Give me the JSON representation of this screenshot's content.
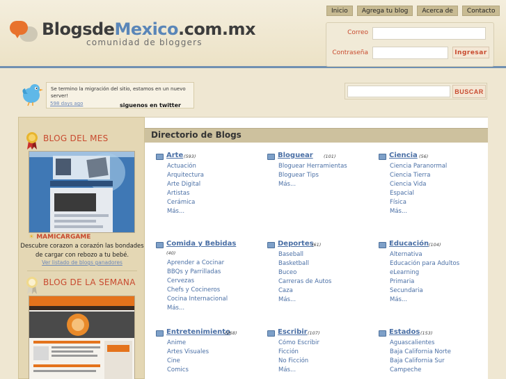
{
  "brand": {
    "title_part1": "BlogsdeMexico",
    "title_part2": ".com.mx",
    "subtitle": "comunidad de bloggers"
  },
  "topnav": [
    {
      "label": "Inicio"
    },
    {
      "label": "Agrega tu blog"
    },
    {
      "label": "Acerca de"
    },
    {
      "label": "Contacto"
    }
  ],
  "login": {
    "email_label": "Correo",
    "password_label": "Contraseña",
    "submit_label": "Ingresar",
    "email_value": "",
    "password_value": ""
  },
  "twitter": {
    "message": "Se termino la migración del sitio, estamos en un nuevo server!",
    "time": "598 days ago",
    "follow": "siguenos en twitter"
  },
  "search": {
    "button_label": "BUSCAR",
    "value": ""
  },
  "sidebar": {
    "blog_del_mes": {
      "title": "BLOG DEL MES",
      "name": "MAMICARGAME",
      "description": "Descubre corazon a corazón las bondades de cargar con rebozo a tu bebé.",
      "link": "Ver listado de blogs ganadores"
    },
    "blog_semana": {
      "title": "BLOG DE LA SEMANA"
    }
  },
  "directory": {
    "title": "Directorio de Blogs",
    "categories": [
      {
        "name": "Arte",
        "count": "(593)",
        "items": [
          "Actuación",
          "Arquitectura",
          "Arte Digital",
          "Artistas",
          "Cerámica",
          "Más..."
        ]
      },
      {
        "name": "Bloguear",
        "count": "(101)",
        "items": [
          "Bloguear Herramientas",
          "Bloguear Tips",
          "Más..."
        ]
      },
      {
        "name": "Ciencia",
        "count": "(56)",
        "items": [
          "Ciencia Paranormal",
          "Ciencia Tierra",
          "Ciencia Vida",
          "Espacial",
          "Física",
          "Más..."
        ]
      },
      {
        "name": "Comida y Bebidas",
        "count": "(40)",
        "items": [
          "Aprender a Cocinar",
          "BBQs y Parrilladas",
          "Cervezas",
          "Chefs y Cocineros",
          "Cocina Internacional",
          "Más..."
        ]
      },
      {
        "name": "Deportes",
        "count": "(61)",
        "items": [
          "Baseball",
          "Basketball",
          "Buceo",
          "Carreras de Autos",
          "Caza",
          "Más..."
        ]
      },
      {
        "name": "Educación",
        "count": "(104)",
        "items": [
          "Alternativa",
          "Educación para Adultos",
          "eLearning",
          "Primaria",
          "Secundaria",
          "Más..."
        ]
      },
      {
        "name": "Entretenimiento",
        "count": "(268)",
        "items": [
          "Anime",
          "Artes Visuales",
          "Cine",
          "Comics"
        ]
      },
      {
        "name": "Escribir",
        "count": "(107)",
        "items": [
          "Cómo Escribir",
          "Ficción",
          "No Ficción",
          "Más..."
        ]
      },
      {
        "name": "Estados",
        "count": "(153)",
        "items": [
          "Aguascalientes",
          "Baja California Norte",
          "Baja California Sur",
          "Campeche"
        ]
      }
    ]
  }
}
